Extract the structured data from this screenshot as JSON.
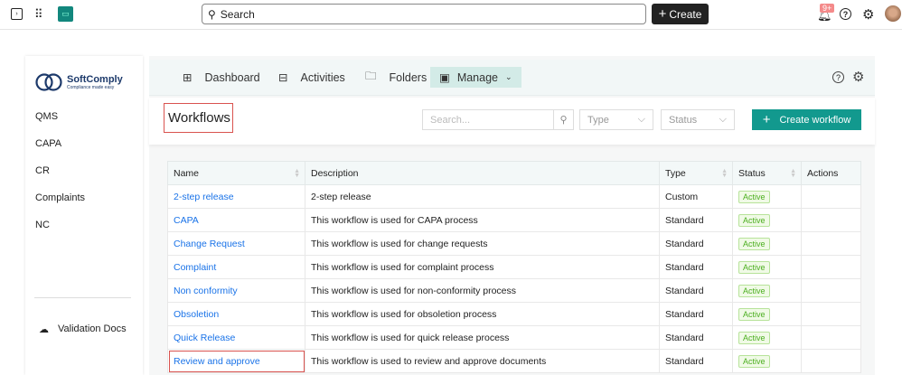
{
  "topbar": {
    "search_placeholder": "Search",
    "create_label": "Create",
    "notification_count": "9+"
  },
  "sidebar": {
    "brand": "SoftComply",
    "tagline": "Compliance made easy",
    "items": [
      {
        "label": "QMS"
      },
      {
        "label": "CAPA"
      },
      {
        "label": "CR"
      },
      {
        "label": "Complaints"
      },
      {
        "label": "NC"
      }
    ],
    "footer": "Validation Docs"
  },
  "nav": {
    "items": [
      {
        "label": "Dashboard"
      },
      {
        "label": "Activities"
      },
      {
        "label": "Folders"
      },
      {
        "label": "Manage"
      }
    ]
  },
  "page": {
    "title": "Workflows",
    "search_placeholder": "Search...",
    "type_filter": "Type",
    "status_filter": "Status",
    "create_label": "Create workflow"
  },
  "table": {
    "headers": [
      "Name",
      "Description",
      "Type",
      "Status",
      "Actions"
    ],
    "rows": [
      {
        "name": "2-step release",
        "description": "2-step release",
        "type": "Custom",
        "status": "Active"
      },
      {
        "name": "CAPA",
        "description": "This workflow is used for CAPA process",
        "type": "Standard",
        "status": "Active"
      },
      {
        "name": "Change Request",
        "description": "This workflow is used for change requests",
        "type": "Standard",
        "status": "Active"
      },
      {
        "name": "Complaint",
        "description": "This workflow is used for complaint process",
        "type": "Standard",
        "status": "Active"
      },
      {
        "name": "Non conformity",
        "description": "This workflow is used for non-conformity process",
        "type": "Standard",
        "status": "Active"
      },
      {
        "name": "Obsoletion",
        "description": "This workflow is used for obsoletion process",
        "type": "Standard",
        "status": "Active"
      },
      {
        "name": "Quick Release",
        "description": "This workflow is used for quick release process",
        "type": "Standard",
        "status": "Active"
      },
      {
        "name": "Review and approve",
        "description": "This workflow is used to review and approve documents",
        "type": "Standard",
        "status": "Active"
      }
    ]
  }
}
